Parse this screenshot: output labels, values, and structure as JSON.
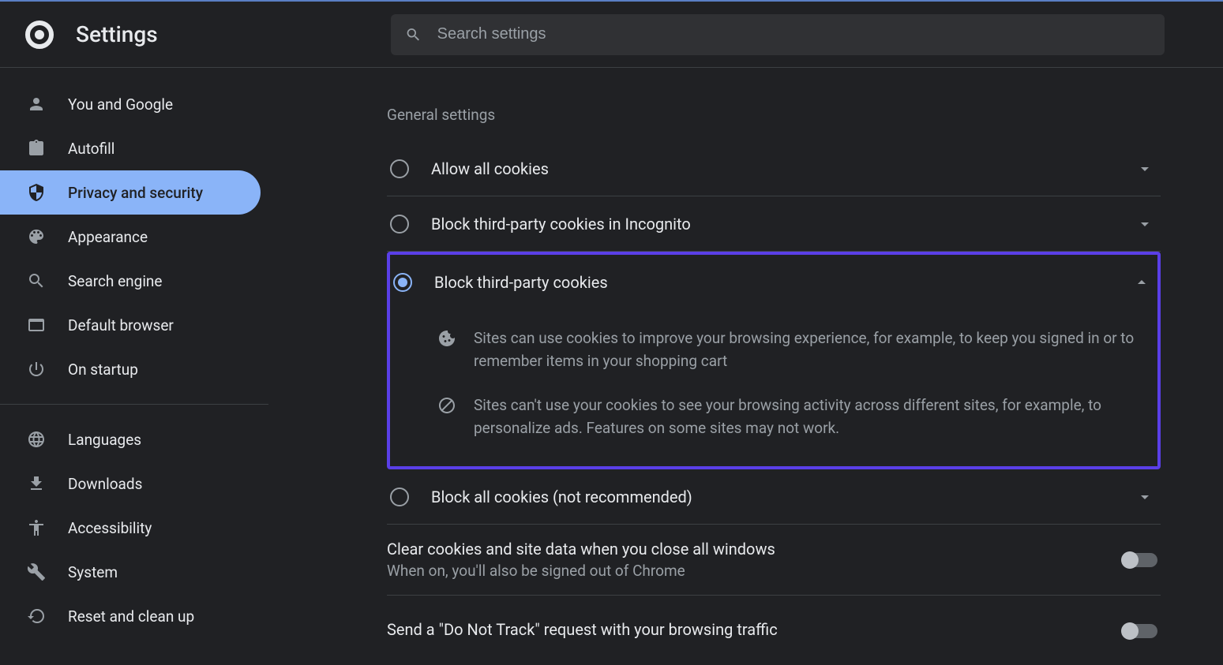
{
  "header": {
    "title": "Settings",
    "search_placeholder": "Search settings"
  },
  "sidebar": {
    "items": [
      {
        "id": "you-and-google",
        "label": "You and Google",
        "active": false
      },
      {
        "id": "autofill",
        "label": "Autofill",
        "active": false
      },
      {
        "id": "privacy-and-security",
        "label": "Privacy and security",
        "active": true
      },
      {
        "id": "appearance",
        "label": "Appearance",
        "active": false
      },
      {
        "id": "search-engine",
        "label": "Search engine",
        "active": false
      },
      {
        "id": "default-browser",
        "label": "Default browser",
        "active": false
      },
      {
        "id": "on-startup",
        "label": "On startup",
        "active": false
      },
      {
        "id": "languages",
        "label": "Languages",
        "active": false
      },
      {
        "id": "downloads",
        "label": "Downloads",
        "active": false
      },
      {
        "id": "accessibility",
        "label": "Accessibility",
        "active": false
      },
      {
        "id": "system",
        "label": "System",
        "active": false
      },
      {
        "id": "reset-and-clean-up",
        "label": "Reset and clean up",
        "active": false
      }
    ]
  },
  "content": {
    "section_heading": "General settings",
    "options": [
      {
        "id": "allow-all",
        "label": "Allow all cookies",
        "selected": false,
        "expanded": false
      },
      {
        "id": "block-third-incognito",
        "label": "Block third-party cookies in Incognito",
        "selected": false,
        "expanded": false
      },
      {
        "id": "block-third",
        "label": "Block third-party cookies",
        "selected": true,
        "expanded": true
      },
      {
        "id": "block-all",
        "label": "Block all cookies (not recommended)",
        "selected": false,
        "expanded": false
      }
    ],
    "expanded_detail": {
      "line1": "Sites can use cookies to improve your browsing experience, for example, to keep you signed in or to remember items in your shopping cart",
      "line2": "Sites can't use your cookies to see your browsing activity across different sites, for example, to personalize ads. Features on some sites may not work."
    },
    "settings": [
      {
        "id": "clear-on-close",
        "title": "Clear cookies and site data when you close all windows",
        "sub": "When on, you'll also be signed out of Chrome",
        "enabled": false
      },
      {
        "id": "do-not-track",
        "title": "Send a \"Do Not Track\" request with your browsing traffic",
        "sub": "",
        "enabled": false
      }
    ]
  }
}
